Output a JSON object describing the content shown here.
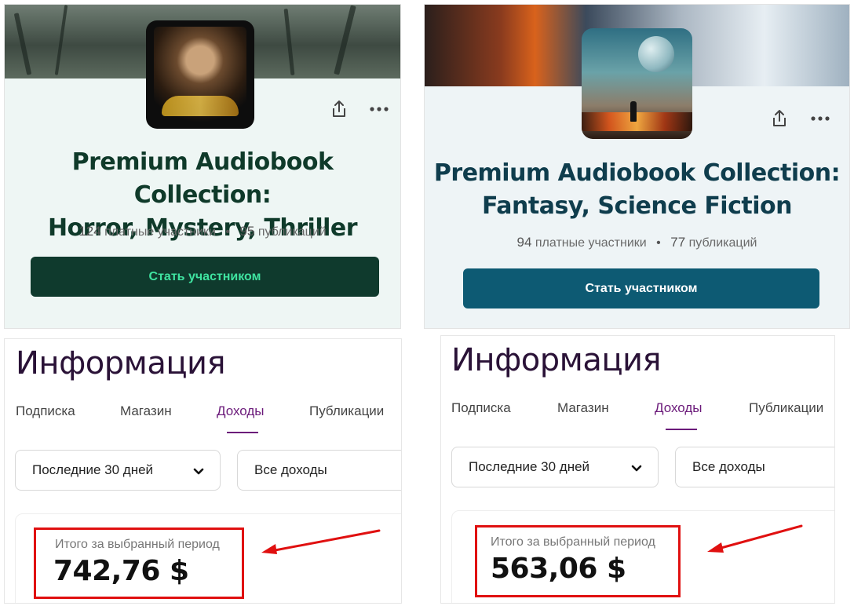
{
  "cards": [
    {
      "title_line1": "Premium Audiobook Collection:",
      "title_line2": "Horror, Mystery, Thriller",
      "members_count": "124",
      "members_label": "платные участники",
      "posts_count": "95",
      "posts_label": "публикаций",
      "join_label": "Стать участником",
      "accent": "#0f3a2d"
    },
    {
      "title_line1": "Premium Audiobook Collection:",
      "title_line2": "Fantasy, Science Fiction",
      "members_count": "94",
      "members_label": "платные участники",
      "posts_count": "77",
      "posts_label": "публикаций",
      "join_label": "Стать участником",
      "accent": "#0d5a73"
    }
  ],
  "panels": [
    {
      "heading": "Информация",
      "tabs": [
        "Подписка",
        "Магазин",
        "Доходы",
        "Публикации"
      ],
      "active_tab": "Доходы",
      "period_select": "Последние 30 дней",
      "income_select": "Все доходы",
      "total_label": "Итого за выбранный период",
      "total_value": "742,76 $"
    },
    {
      "heading": "Информация",
      "tabs": [
        "Подписка",
        "Магазин",
        "Доходы",
        "Публикации"
      ],
      "active_tab": "Доходы",
      "period_select": "Последние 30 дней",
      "income_select": "Все доходы",
      "total_label": "Итого за выбранный период",
      "total_value": "563,06 $"
    }
  ],
  "icons": {
    "share": "share-icon",
    "more": "more-icon",
    "chevron": "chevron-down-icon"
  },
  "colors": {
    "highlight": "#e01010",
    "active_tab": "#6b1a7a",
    "heading": "#2a1237"
  }
}
